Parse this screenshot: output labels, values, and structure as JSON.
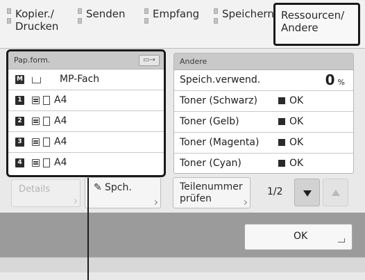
{
  "tabs": [
    {
      "line1": "Kopier./",
      "line2": "Drucken",
      "active": false
    },
    {
      "line1": "Senden",
      "line2": "",
      "active": false
    },
    {
      "line1": "Empfang",
      "line2": "",
      "active": false
    },
    {
      "line1": "Speichern",
      "line2": "",
      "active": false
    },
    {
      "line1": "Ressourcen/",
      "line2": "Andere",
      "active": true
    }
  ],
  "paper": {
    "header": "Pap.form.",
    "header_button_icon": "tray-select-icon",
    "rows": [
      {
        "number": "M",
        "value": "MP-Fach",
        "type": "mp"
      },
      {
        "number": "1",
        "value": "A4",
        "type": "drawer"
      },
      {
        "number": "2",
        "value": "A4",
        "type": "drawer"
      },
      {
        "number": "3",
        "value": "A4",
        "type": "drawer"
      },
      {
        "number": "4",
        "value": "A4",
        "type": "drawer"
      }
    ]
  },
  "other": {
    "header": "Andere",
    "memory": {
      "label": "Speich.verwend.",
      "value": "0",
      "unit": "%"
    },
    "toners": [
      {
        "label": "Toner (Schwarz)",
        "status": "OK"
      },
      {
        "label": "Toner (Gelb)",
        "status": "OK"
      },
      {
        "label": "Toner (Magenta)",
        "status": "OK"
      },
      {
        "label": "Toner (Cyan)",
        "status": "OK"
      }
    ]
  },
  "buttons": {
    "details": "Details",
    "spch": "Spch.",
    "teil_line1": "Teilenummer",
    "teil_line2": "prüfen",
    "page": "1/2",
    "ok": "OK"
  }
}
